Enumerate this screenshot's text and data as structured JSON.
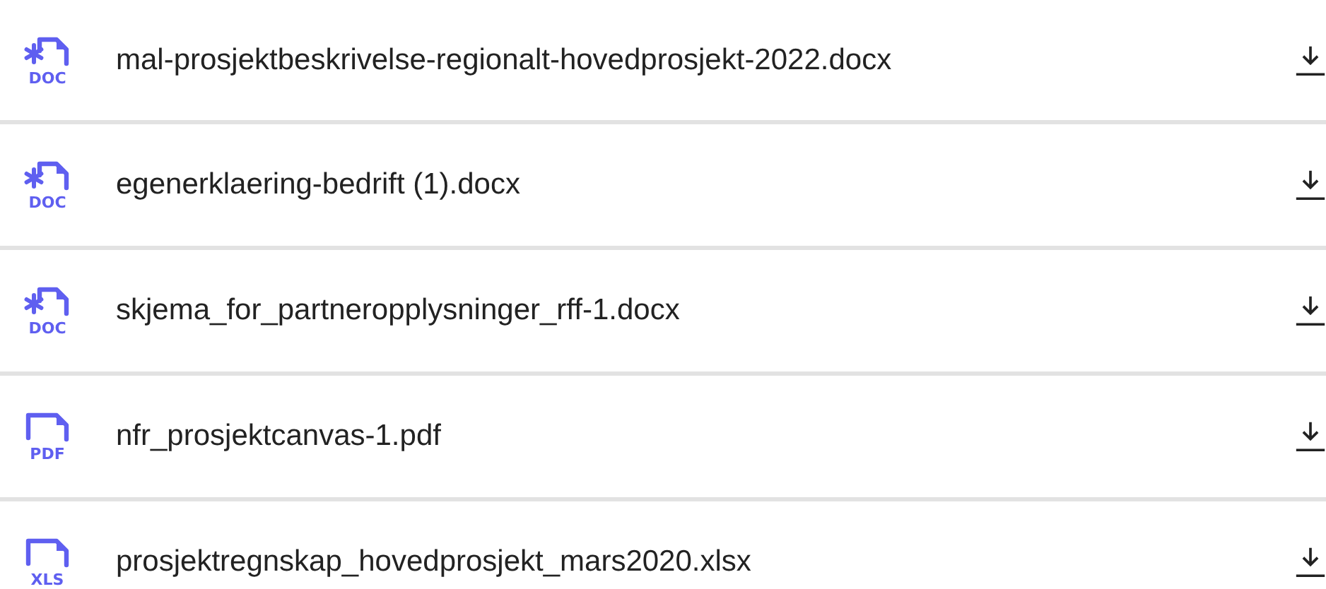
{
  "files": [
    {
      "name": "mal-prosjektbeskrivelse-regionalt-hovedprosjekt-2022.docx",
      "kind": "doc",
      "type_label": "DOC"
    },
    {
      "name": "egenerklaering-bedrift (1).docx",
      "kind": "doc",
      "type_label": "DOC"
    },
    {
      "name": "skjema_for_partneropplysninger_rff-1.docx",
      "kind": "doc",
      "type_label": "DOC"
    },
    {
      "name": "nfr_prosjektcanvas-1.pdf",
      "kind": "pdf",
      "type_label": "PDF"
    },
    {
      "name": "prosjektregnskap_hovedprosjekt_mars2020.xlsx",
      "kind": "xls",
      "type_label": "XLS"
    }
  ]
}
